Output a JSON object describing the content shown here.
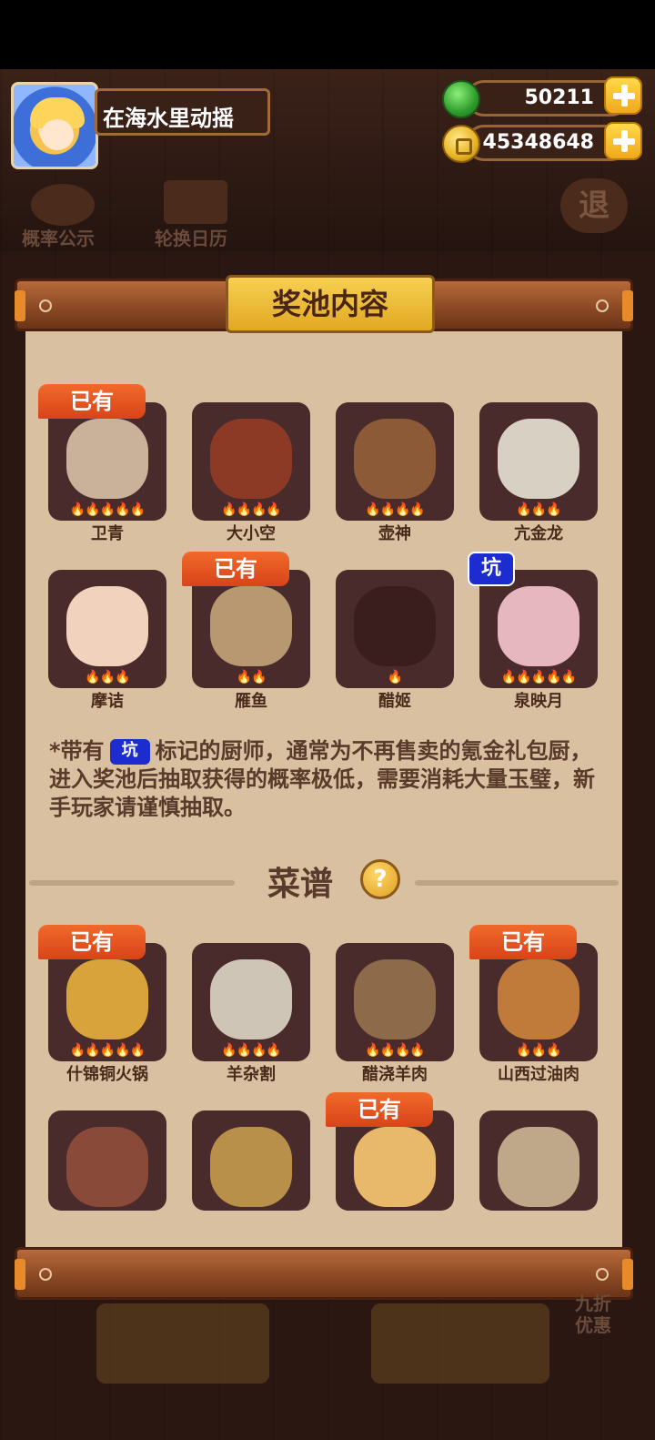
{
  "user": {
    "name": "在海水里动摇"
  },
  "resources": {
    "jade": "50211",
    "coins": "45348648"
  },
  "hud": {
    "probability_label": "概率公示",
    "calendar_label": "轮换日历",
    "exit_label": "退"
  },
  "panel": {
    "title": "奖池内容"
  },
  "badges": {
    "owned": "已有",
    "pit": "坑"
  },
  "chefs": [
    {
      "name": "卫青",
      "stars": 5,
      "owned": true,
      "pit": false,
      "art_color": "#c9b19a"
    },
    {
      "name": "大小空",
      "stars": 4,
      "owned": false,
      "pit": false,
      "art_color": "#8c3a26"
    },
    {
      "name": "壶神",
      "stars": 4,
      "owned": false,
      "pit": false,
      "art_color": "#8c5a36"
    },
    {
      "name": "亢金龙",
      "stars": 3,
      "owned": false,
      "pit": false,
      "art_color": "#d9d0c4"
    },
    {
      "name": "摩诘",
      "stars": 3,
      "owned": false,
      "pit": false,
      "art_color": "#f0d2bd"
    },
    {
      "name": "雁鱼",
      "stars": 2,
      "owned": true,
      "pit": false,
      "art_color": "#b79870"
    },
    {
      "name": "醋姬",
      "stars": 1,
      "owned": false,
      "pit": false,
      "art_color": "#3a1e1e"
    },
    {
      "name": "泉映月",
      "stars": 5,
      "owned": false,
      "pit": true,
      "art_color": "#e7b7c0"
    }
  ],
  "note": {
    "prefix": "*带有",
    "pit_word": "坑",
    "text": "标记的厨师，通常为不再售卖的氪金礼包厨，进入奖池后抽取获得的概率极低，需要消耗大量玉璧，新手玩家请谨慎抽取。"
  },
  "recipes_section": {
    "title": "菜谱",
    "help": "?"
  },
  "recipes": [
    {
      "name": "什锦铜火锅",
      "stars": 5,
      "owned": true,
      "art_color": "#d8a33a"
    },
    {
      "name": "羊杂割",
      "stars": 4,
      "owned": false,
      "art_color": "#cfc5b6"
    },
    {
      "name": "醋浇羊肉",
      "stars": 4,
      "owned": false,
      "art_color": "#8c6a4a"
    },
    {
      "name": "山西过油肉",
      "stars": 3,
      "owned": true,
      "art_color": "#c07a3a"
    },
    {
      "name": "",
      "stars": 0,
      "owned": false,
      "art_color": "#8a4a3a"
    },
    {
      "name": "",
      "stars": 0,
      "owned": false,
      "art_color": "#b9904a"
    },
    {
      "name": "",
      "stars": 0,
      "owned": true,
      "art_color": "#e8b96a"
    },
    {
      "name": "",
      "stars": 0,
      "owned": false,
      "art_color": "#bfa78a"
    }
  ],
  "bottom": {
    "discount_label": "九折优惠"
  }
}
